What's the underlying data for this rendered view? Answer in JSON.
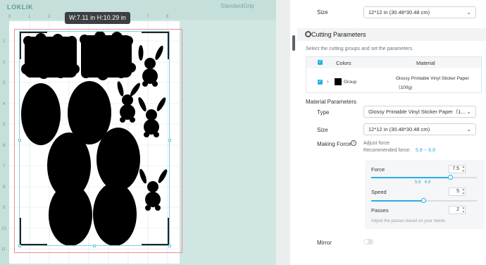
{
  "canvas": {
    "logo": "LOKLIK",
    "mat_type": "StandardGrip",
    "ruler_top": [
      "0",
      "1",
      "2",
      "3",
      "4",
      "5",
      "6",
      "7",
      "8"
    ],
    "ruler_left": [
      "1",
      "2",
      "3",
      "4",
      "5",
      "6",
      "7",
      "8",
      "9",
      "10",
      "11"
    ],
    "tooltip": "W:7.11 in  H:10.29 in",
    "shapes": [
      "word-block-1",
      "word-block-2",
      "egg",
      "bunny"
    ]
  },
  "panel": {
    "top_size": {
      "label": "Size",
      "value": "12*12 in (30.48*30.48 cm)"
    },
    "cutting": {
      "title": "Cutting Parameters",
      "hint": "Select the cutting groups and set the parameters.",
      "col_colors": "Colors",
      "col_material": "Material",
      "group_label": "Group",
      "group_material": "Glossy Printable Vinyl Sticker Paper",
      "group_material_weight": "（100g)"
    },
    "material_params": {
      "title": "Material Parameters",
      "type_label": "Type",
      "type_value": "Glossy Printable Vinyl Sticker Paper（1...",
      "size_label": "Size",
      "size_value": "12*12 in (30.48*30.48 cm)",
      "force_label": "Making Force",
      "adjust": "Adjust force",
      "recommended": "Recommended force:",
      "recommended_range": "5.8 -- 6.8"
    },
    "force": {
      "force_label": "Force",
      "force_value": "7.5",
      "force_fraction": 0.75,
      "tick_low": "5.8",
      "tick_high": "6.8",
      "speed_label": "Speed",
      "speed_value": "5",
      "speed_fraction": 0.5,
      "passes_label": "Passes",
      "passes_value": "2",
      "hint": "Adjust the passes based on your needs."
    },
    "mirror_label": "Mirror",
    "accent": "#29aee6"
  }
}
